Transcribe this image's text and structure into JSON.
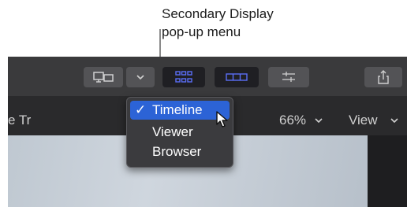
{
  "callout": {
    "line1": "Secondary Display",
    "line2": "pop-up menu"
  },
  "toolbar": {
    "buttons": [
      {
        "name": "secondary-display-button",
        "icon": "display-icon",
        "active": false
      },
      {
        "name": "secondary-display-menu-button",
        "icon": "chevron-down-icon",
        "active": false
      },
      {
        "name": "browser-view-button",
        "icon": "grid-icon",
        "active": true
      },
      {
        "name": "timeline-view-button",
        "icon": "timeline-icon",
        "active": true
      },
      {
        "name": "inspector-button",
        "icon": "sliders-icon",
        "active": false
      },
      {
        "name": "share-button",
        "icon": "share-icon",
        "active": false
      }
    ]
  },
  "header": {
    "left_text": "e Tr",
    "zoom_value": "66%",
    "view_label": "View"
  },
  "popup_menu": {
    "items": [
      {
        "label": "Timeline",
        "checked": true,
        "check_mark": "✓"
      },
      {
        "label": "Viewer",
        "checked": false
      },
      {
        "label": "Browser",
        "checked": false
      }
    ]
  },
  "colors": {
    "toolbar_bg": "#3a3a3c",
    "header_bg": "#2a2a2c",
    "selection": "#2c63d6",
    "active_icon": "#5b6ef5"
  }
}
